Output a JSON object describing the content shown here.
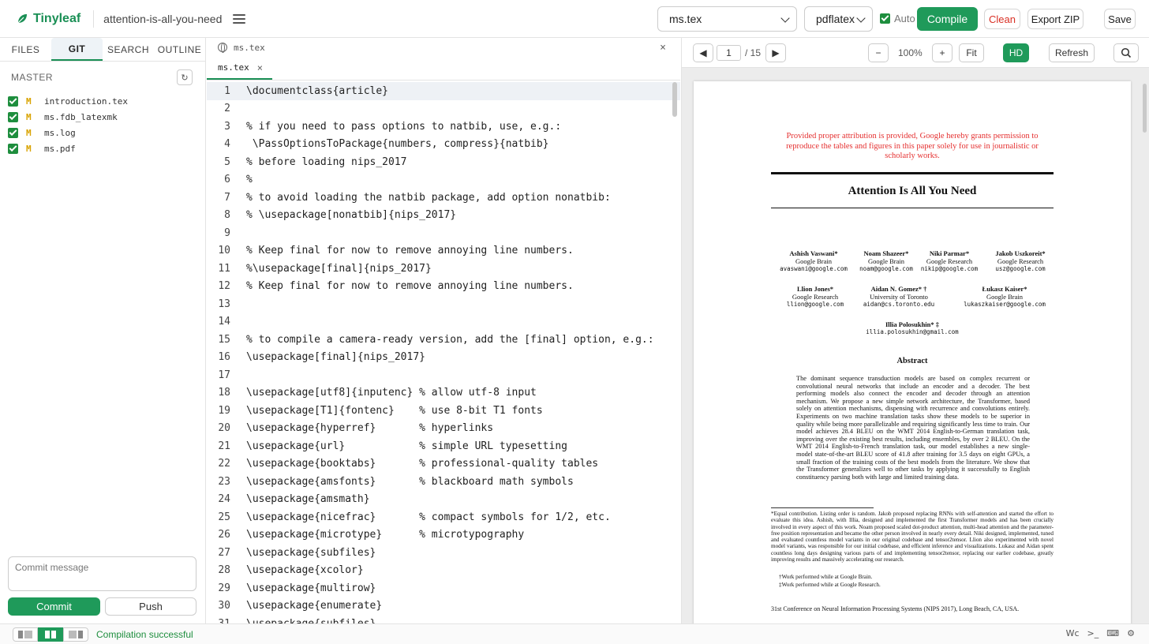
{
  "app": {
    "name": "Tinyleaf",
    "project": "attention-is-all-you-need"
  },
  "topbar": {
    "file_select": "ms.tex",
    "engine_select": "pdflatex",
    "auto_label": "Auto",
    "compile": "Compile",
    "clean": "Clean",
    "export": "Export ZIP",
    "save": "Save"
  },
  "sidebar": {
    "tabs": [
      "FILES",
      "GIT",
      "SEARCH",
      "OUTLINE"
    ],
    "active_tab": "GIT",
    "branch": "MASTER",
    "files": [
      {
        "status": "M",
        "name": "introduction.tex"
      },
      {
        "status": "M",
        "name": "ms.fdb_latexmk"
      },
      {
        "status": "M",
        "name": "ms.log"
      },
      {
        "status": "M",
        "name": "ms.pdf"
      }
    ],
    "commit_placeholder": "Commit message",
    "commit_btn": "Commit",
    "push_btn": "Push"
  },
  "editor": {
    "path": "ms.tex",
    "tab": "ms.tex",
    "lines": [
      "\\documentclass{article}",
      "",
      "% if you need to pass options to natbib, use, e.g.:",
      " \\PassOptionsToPackage{numbers, compress}{natbib}",
      "% before loading nips_2017",
      "%",
      "% to avoid loading the natbib package, add option nonatbib:",
      "% \\usepackage[nonatbib]{nips_2017}",
      "",
      "% Keep final for now to remove annoying line numbers.",
      "%\\usepackage[final]{nips_2017}",
      "% Keep final for now to remove annoying line numbers.",
      "",
      "",
      "% to compile a camera-ready version, add the [final] option, e.g.:",
      "\\usepackage[final]{nips_2017}",
      "",
      "\\usepackage[utf8]{inputenc} % allow utf-8 input",
      "\\usepackage[T1]{fontenc}    % use 8-bit T1 fonts",
      "\\usepackage{hyperref}       % hyperlinks",
      "\\usepackage{url}            % simple URL typesetting",
      "\\usepackage{booktabs}       % professional-quality tables",
      "\\usepackage{amsfonts}       % blackboard math symbols",
      "\\usepackage{amsmath}",
      "\\usepackage{nicefrac}       % compact symbols for 1/2, etc.",
      "\\usepackage{microtype}      % microtypography",
      "\\usepackage{subfiles}",
      "\\usepackage{xcolor}",
      "\\usepackage{multirow}",
      "\\usepackage{enumerate}",
      "\\usepackage{subfiles}"
    ]
  },
  "pdf": {
    "page": "1",
    "total": "/ 15",
    "zoom_minus": "−",
    "zoom": "100%",
    "zoom_plus": "+",
    "fit": "Fit",
    "hd": "HD",
    "refresh": "Refresh",
    "permission": "Provided proper attribution is provided, Google hereby grants permission to reproduce the tables and figures in this paper solely for use in journalistic or scholarly works.",
    "title": "Attention Is All You Need",
    "authors": [
      {
        "name": "Ashish Vaswani*",
        "org": "Google Brain",
        "email": "avaswani@google.com"
      },
      {
        "name": "Noam Shazeer*",
        "org": "Google Brain",
        "email": "noam@google.com"
      },
      {
        "name": "Niki Parmar*",
        "org": "Google Research",
        "email": "nikip@google.com"
      },
      {
        "name": "Jakob Uszkoreit*",
        "org": "Google Research",
        "email": "usz@google.com"
      },
      {
        "name": "Llion Jones*",
        "org": "Google Research",
        "email": "llion@google.com"
      },
      {
        "name": "Aidan N. Gomez* †",
        "org": "University of Toronto",
        "email": "aidan@cs.toronto.edu"
      },
      {
        "name": "Łukasz Kaiser*",
        "org": "Google Brain",
        "email": "lukaszkaiser@google.com"
      },
      {
        "name": "Illia Polosukhin* ‡",
        "org": "",
        "email": "illia.polosukhin@gmail.com"
      }
    ],
    "abstract_title": "Abstract",
    "abstract": "The dominant sequence transduction models are based on complex recurrent or convolutional neural networks that include an encoder and a decoder. The best performing models also connect the encoder and decoder through an attention mechanism. We propose a new simple network architecture, the Transformer, based solely on attention mechanisms, dispensing with recurrence and convolutions entirely. Experiments on two machine translation tasks show these models to be superior in quality while being more parallelizable and requiring significantly less time to train. Our model achieves 28.4 BLEU on the WMT 2014 English-to-German translation task, improving over the existing best results, including ensembles, by over 2 BLEU. On the WMT 2014 English-to-French translation task, our model establishes a new single-model state-of-the-art BLEU score of 41.8 after training for 3.5 days on eight GPUs, a small fraction of the training costs of the best models from the literature. We show that the Transformer generalizes well to other tasks by applying it successfully to English constituency parsing both with large and limited training data.",
    "footnote1": "*Equal contribution. Listing order is random. Jakob proposed replacing RNNs with self-attention and started the effort to evaluate this idea. Ashish, with Illia, designed and implemented the first Transformer models and has been crucially involved in every aspect of this work. Noam proposed scaled dot-product attention, multi-head attention and the parameter-free position representation and became the other person involved in nearly every detail. Niki designed, implemented, tuned and evaluated countless model variants in our original codebase and tensor2tensor. Llion also experimented with novel model variants, was responsible for our initial codebase, and efficient inference and visualizations. Lukasz and Aidan spent countless long days designing various parts of and implementing tensor2tensor, replacing our earlier codebase, greatly improving results and massively accelerating our research.",
    "footnote2": "†Work performed while at Google Brain.",
    "footnote3": "‡Work performed while at Google Research.",
    "conference": "31st Conference on Neural Information Processing Systems (NIPS 2017), Long Beach, CA, USA."
  },
  "status": {
    "text": "Compilation successful",
    "icons": [
      "Wc",
      ">_",
      "keyboard-icon",
      "gear-icon"
    ]
  },
  "colors": {
    "brand": "#1a8f55",
    "success": "#1e8e3e",
    "danger": "#d93025",
    "modified": "#d9a300"
  }
}
